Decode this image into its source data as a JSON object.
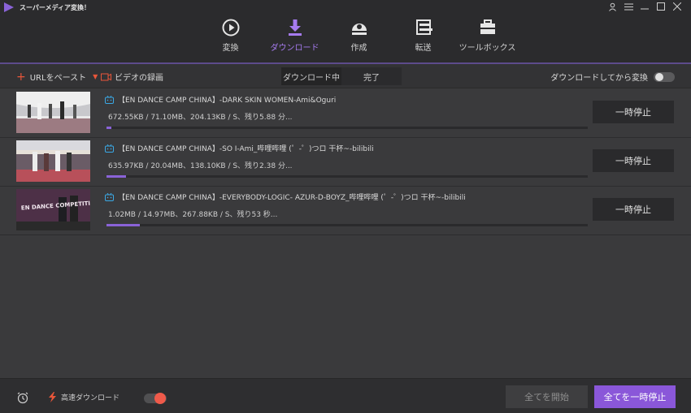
{
  "app": {
    "title": "スーパーメディア変換！"
  },
  "nav": [
    {
      "label": "変換",
      "icon": "convert-icon"
    },
    {
      "label": "ダウンロード",
      "icon": "download-icon"
    },
    {
      "label": "作成",
      "icon": "burn-icon"
    },
    {
      "label": "転送",
      "icon": "transfer-icon"
    },
    {
      "label": "ツールボックス",
      "icon": "toolbox-icon"
    }
  ],
  "toolbar": {
    "url_paste": "URLをペースト",
    "screen_record": "ビデオの録画",
    "tabs": [
      "ダウンロード中",
      "完了"
    ],
    "convert_after": "ダウンロードしてから変換"
  },
  "downloads": [
    {
      "title": "【EN DANCE CAMP CHINA】-DARK SKIN WOMEN-Ami&Oguri",
      "stats": "672.55KB / 71.10MB、204.13KB / S、残り5.88 分...",
      "progress": 0.01,
      "button": "一時停止"
    },
    {
      "title": "【EN DANCE CAMP CHINA】-SO I-Ami_哔哩哔哩 (゜-゜)つロ 干杯~-bilibili",
      "stats": "635.97KB / 20.04MB、138.10KB / S、残り2.38 分...",
      "progress": 0.04,
      "button": "一時停止"
    },
    {
      "title": "【EN DANCE CAMP CHINA】-EVERYBODY-LOGIC- AZUR-D-BOYZ_哔哩哔哩 (゜-゜)つロ 干杯~-bilibili",
      "stats": "1.02MB / 14.97MB、267.88KB / S、残り53 秒...",
      "progress": 0.07,
      "button": "一時停止",
      "thumb_text": "EN DANCE COMPETITION"
    }
  ],
  "footer": {
    "high_speed": "高速ダウンロード",
    "start_all": "全てを開始",
    "pause_all": "全てを一時停止"
  },
  "colors": {
    "accent": "#8a57d9",
    "toggle_on": "#ef5a4a"
  }
}
